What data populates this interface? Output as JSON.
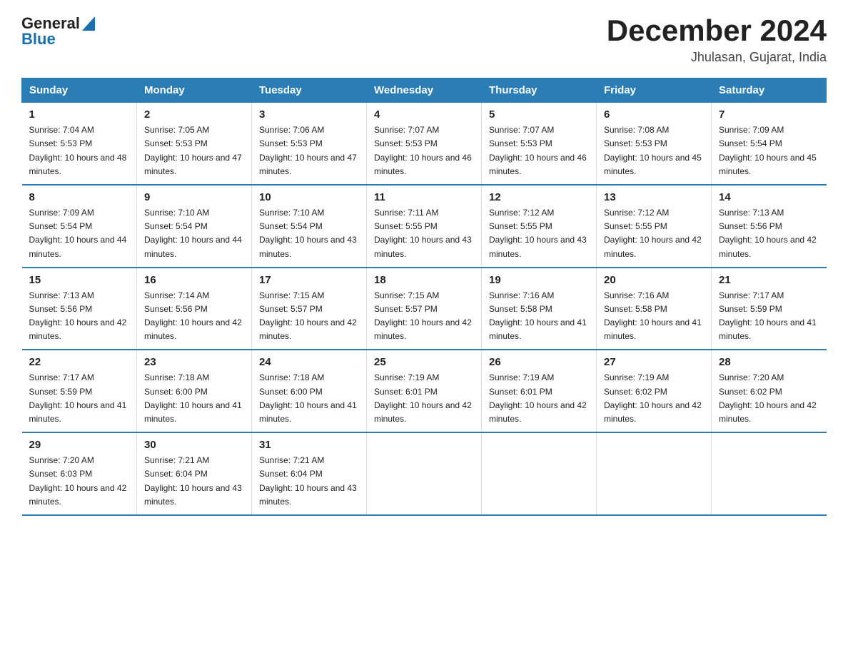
{
  "header": {
    "logo_general": "General",
    "logo_blue": "Blue",
    "month_year": "December 2024",
    "location": "Jhulasan, Gujarat, India"
  },
  "days_of_week": [
    "Sunday",
    "Monday",
    "Tuesday",
    "Wednesday",
    "Thursday",
    "Friday",
    "Saturday"
  ],
  "weeks": [
    [
      {
        "day": "1",
        "sunrise": "7:04 AM",
        "sunset": "5:53 PM",
        "daylight": "10 hours and 48 minutes."
      },
      {
        "day": "2",
        "sunrise": "7:05 AM",
        "sunset": "5:53 PM",
        "daylight": "10 hours and 47 minutes."
      },
      {
        "day": "3",
        "sunrise": "7:06 AM",
        "sunset": "5:53 PM",
        "daylight": "10 hours and 47 minutes."
      },
      {
        "day": "4",
        "sunrise": "7:07 AM",
        "sunset": "5:53 PM",
        "daylight": "10 hours and 46 minutes."
      },
      {
        "day": "5",
        "sunrise": "7:07 AM",
        "sunset": "5:53 PM",
        "daylight": "10 hours and 46 minutes."
      },
      {
        "day": "6",
        "sunrise": "7:08 AM",
        "sunset": "5:53 PM",
        "daylight": "10 hours and 45 minutes."
      },
      {
        "day": "7",
        "sunrise": "7:09 AM",
        "sunset": "5:54 PM",
        "daylight": "10 hours and 45 minutes."
      }
    ],
    [
      {
        "day": "8",
        "sunrise": "7:09 AM",
        "sunset": "5:54 PM",
        "daylight": "10 hours and 44 minutes."
      },
      {
        "day": "9",
        "sunrise": "7:10 AM",
        "sunset": "5:54 PM",
        "daylight": "10 hours and 44 minutes."
      },
      {
        "day": "10",
        "sunrise": "7:10 AM",
        "sunset": "5:54 PM",
        "daylight": "10 hours and 43 minutes."
      },
      {
        "day": "11",
        "sunrise": "7:11 AM",
        "sunset": "5:55 PM",
        "daylight": "10 hours and 43 minutes."
      },
      {
        "day": "12",
        "sunrise": "7:12 AM",
        "sunset": "5:55 PM",
        "daylight": "10 hours and 43 minutes."
      },
      {
        "day": "13",
        "sunrise": "7:12 AM",
        "sunset": "5:55 PM",
        "daylight": "10 hours and 42 minutes."
      },
      {
        "day": "14",
        "sunrise": "7:13 AM",
        "sunset": "5:56 PM",
        "daylight": "10 hours and 42 minutes."
      }
    ],
    [
      {
        "day": "15",
        "sunrise": "7:13 AM",
        "sunset": "5:56 PM",
        "daylight": "10 hours and 42 minutes."
      },
      {
        "day": "16",
        "sunrise": "7:14 AM",
        "sunset": "5:56 PM",
        "daylight": "10 hours and 42 minutes."
      },
      {
        "day": "17",
        "sunrise": "7:15 AM",
        "sunset": "5:57 PM",
        "daylight": "10 hours and 42 minutes."
      },
      {
        "day": "18",
        "sunrise": "7:15 AM",
        "sunset": "5:57 PM",
        "daylight": "10 hours and 42 minutes."
      },
      {
        "day": "19",
        "sunrise": "7:16 AM",
        "sunset": "5:58 PM",
        "daylight": "10 hours and 41 minutes."
      },
      {
        "day": "20",
        "sunrise": "7:16 AM",
        "sunset": "5:58 PM",
        "daylight": "10 hours and 41 minutes."
      },
      {
        "day": "21",
        "sunrise": "7:17 AM",
        "sunset": "5:59 PM",
        "daylight": "10 hours and 41 minutes."
      }
    ],
    [
      {
        "day": "22",
        "sunrise": "7:17 AM",
        "sunset": "5:59 PM",
        "daylight": "10 hours and 41 minutes."
      },
      {
        "day": "23",
        "sunrise": "7:18 AM",
        "sunset": "6:00 PM",
        "daylight": "10 hours and 41 minutes."
      },
      {
        "day": "24",
        "sunrise": "7:18 AM",
        "sunset": "6:00 PM",
        "daylight": "10 hours and 41 minutes."
      },
      {
        "day": "25",
        "sunrise": "7:19 AM",
        "sunset": "6:01 PM",
        "daylight": "10 hours and 42 minutes."
      },
      {
        "day": "26",
        "sunrise": "7:19 AM",
        "sunset": "6:01 PM",
        "daylight": "10 hours and 42 minutes."
      },
      {
        "day": "27",
        "sunrise": "7:19 AM",
        "sunset": "6:02 PM",
        "daylight": "10 hours and 42 minutes."
      },
      {
        "day": "28",
        "sunrise": "7:20 AM",
        "sunset": "6:02 PM",
        "daylight": "10 hours and 42 minutes."
      }
    ],
    [
      {
        "day": "29",
        "sunrise": "7:20 AM",
        "sunset": "6:03 PM",
        "daylight": "10 hours and 42 minutes."
      },
      {
        "day": "30",
        "sunrise": "7:21 AM",
        "sunset": "6:04 PM",
        "daylight": "10 hours and 43 minutes."
      },
      {
        "day": "31",
        "sunrise": "7:21 AM",
        "sunset": "6:04 PM",
        "daylight": "10 hours and 43 minutes."
      },
      null,
      null,
      null,
      null
    ]
  ],
  "labels": {
    "sunrise": "Sunrise:",
    "sunset": "Sunset:",
    "daylight": "Daylight:"
  }
}
